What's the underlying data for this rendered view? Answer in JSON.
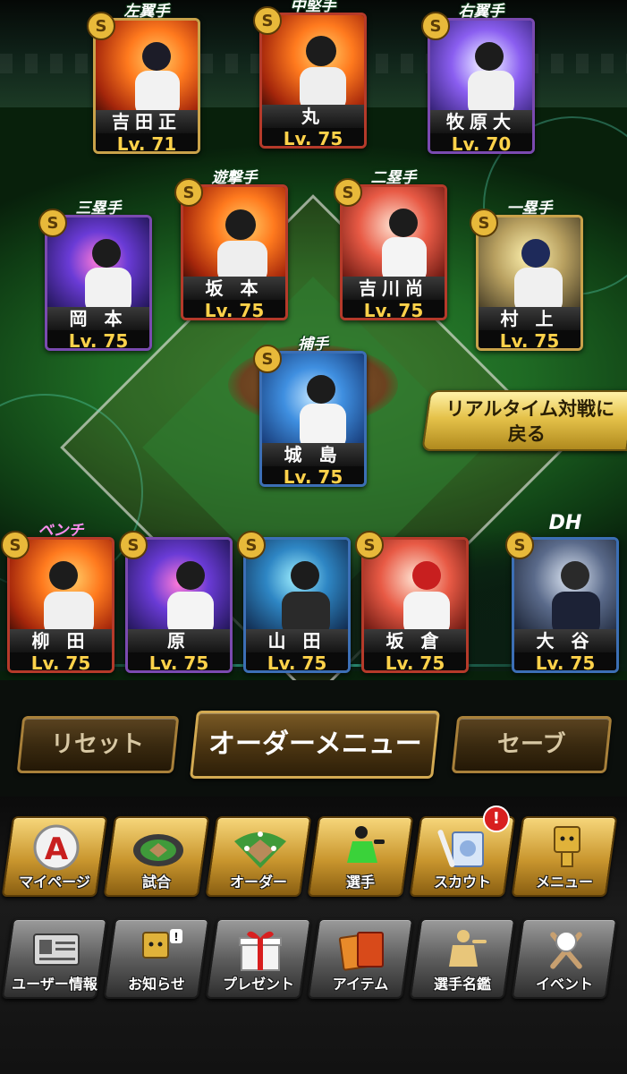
{
  "lineup": {
    "left_field": {
      "position": "左翼手",
      "name": "吉田正",
      "level": "Lv. 71",
      "rank": "S"
    },
    "center_field": {
      "position": "中堅手",
      "name": "丸",
      "level": "Lv. 75",
      "rank": "S"
    },
    "right_field": {
      "position": "右翼手",
      "name": "牧原大",
      "level": "Lv. 70",
      "rank": "S"
    },
    "shortstop": {
      "position": "遊撃手",
      "name": "坂 本",
      "level": "Lv. 75",
      "rank": "S"
    },
    "second_base": {
      "position": "二塁手",
      "name": "吉川尚",
      "level": "Lv. 75",
      "rank": "S"
    },
    "third_base": {
      "position": "三塁手",
      "name": "岡 本",
      "level": "Lv. 75",
      "rank": "S"
    },
    "first_base": {
      "position": "一塁手",
      "name": "村 上",
      "level": "Lv. 75",
      "rank": "S"
    },
    "catcher": {
      "position": "捕手",
      "name": "城 島",
      "level": "Lv. 75",
      "rank": "S"
    }
  },
  "bench": {
    "label": "ベンチ",
    "players": [
      {
        "name": "柳 田",
        "level": "Lv. 75",
        "rank": "S"
      },
      {
        "name": "原",
        "level": "Lv. 75",
        "rank": "S"
      },
      {
        "name": "山 田",
        "level": "Lv. 75",
        "rank": "S"
      },
      {
        "name": "坂 倉",
        "level": "Lv. 75",
        "rank": "S"
      }
    ]
  },
  "dh": {
    "position": "DH",
    "name": "大 谷",
    "level": "Lv. 75",
    "rank": "S"
  },
  "realtime_button": {
    "line1": "リアルタイム対戦に",
    "line2": "戻る"
  },
  "order_controls": {
    "reset": "リセット",
    "order_menu": "オーダーメニュー",
    "save": "セーブ"
  },
  "main_menu": [
    {
      "label": "マイページ",
      "icon": "my-page-a-icon"
    },
    {
      "label": "試合",
      "icon": "stadium-icon"
    },
    {
      "label": "オーダー",
      "icon": "field-order-icon"
    },
    {
      "label": "選手",
      "icon": "player-pitcher-icon"
    },
    {
      "label": "スカウト",
      "icon": "scout-bat-icon",
      "badge": "!"
    },
    {
      "label": "メニュー",
      "icon": "box-mascot-icon"
    }
  ],
  "sub_menu": [
    {
      "label": "ユーザー情報",
      "icon": "user-info-card-icon"
    },
    {
      "label": "お知らせ",
      "icon": "notice-mascot-icon"
    },
    {
      "label": "プレゼント",
      "icon": "gift-box-icon"
    },
    {
      "label": "アイテム",
      "icon": "item-book-icon"
    },
    {
      "label": "選手名鑑",
      "icon": "player-directory-icon"
    },
    {
      "label": "イベント",
      "icon": "crossed-bats-ball-icon"
    }
  ],
  "colors": {
    "level_text": "#ffd24a",
    "bench_label": "#ff8df0",
    "menu_gold": "#c9962e",
    "menu_gray": "#5e5e5e",
    "realtime_gold": "#e5c24a"
  }
}
